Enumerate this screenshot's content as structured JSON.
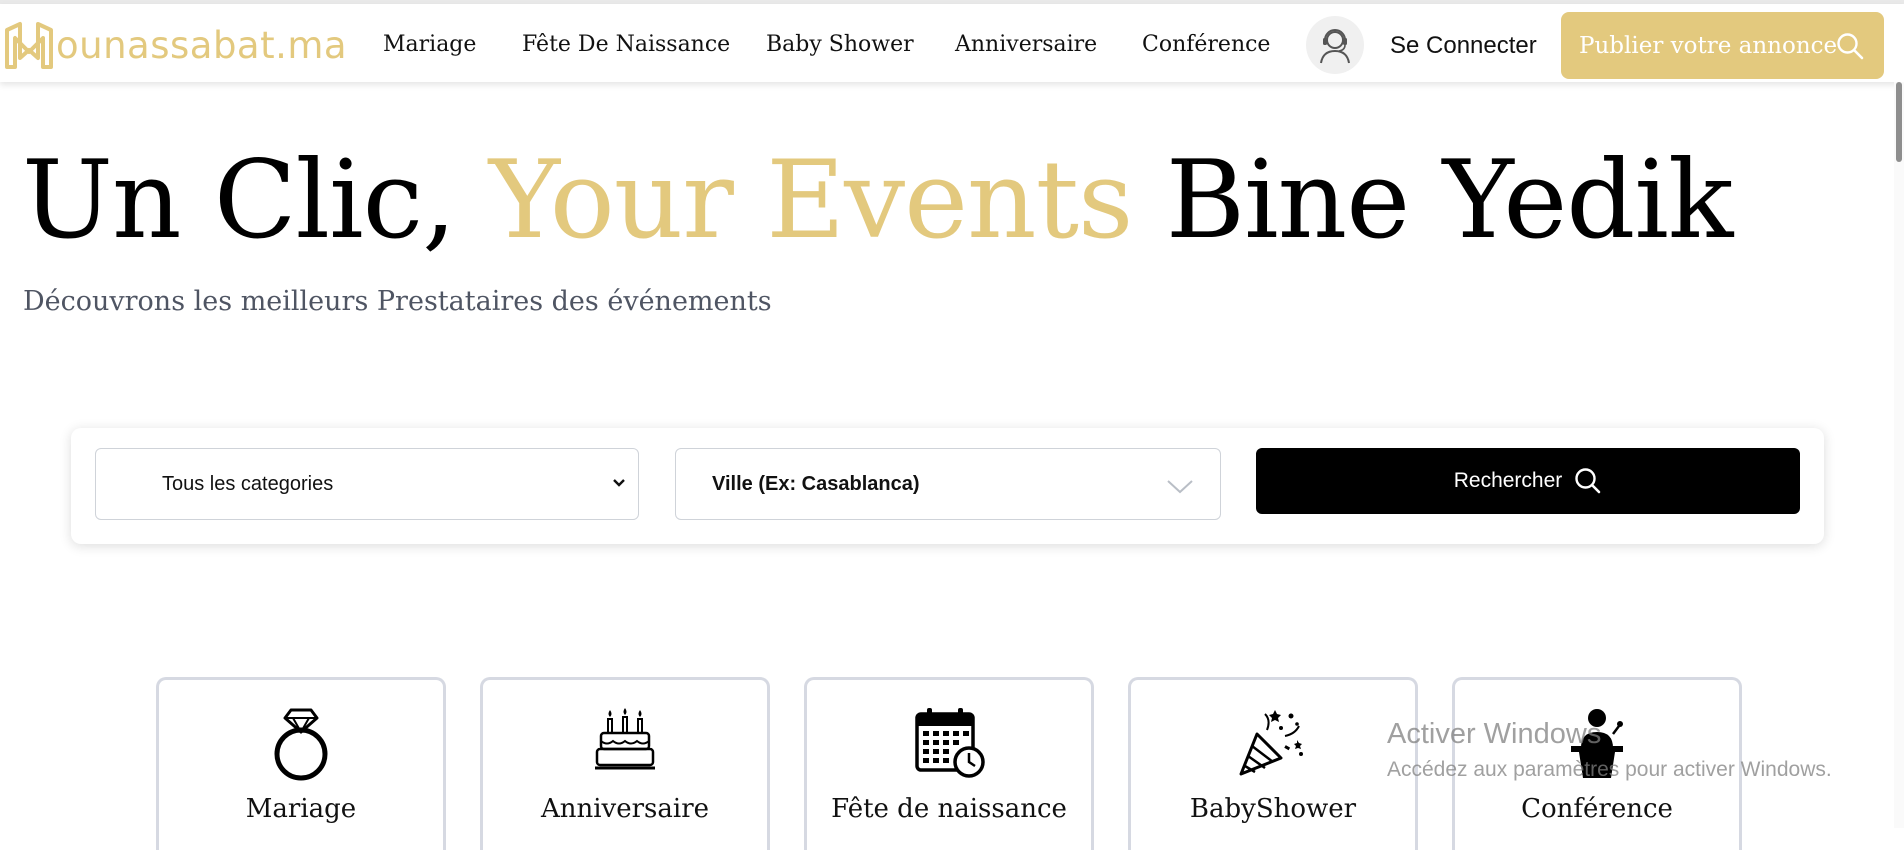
{
  "header": {
    "logo_text": "ounassabat.ma",
    "nav": [
      "Mariage",
      "Fête De Naissance",
      "Baby Shower",
      "Anniversaire",
      "Conférence"
    ],
    "login_label": "Se Connecter",
    "publish_label": "Publier votre annonce"
  },
  "hero": {
    "title_part1": "Un Clic,",
    "title_highlight": "Your Events",
    "title_part2": "Bine Yedik",
    "subtitle": "Découvrons les meilleurs Prestataires des événements"
  },
  "search": {
    "category_value": "Tous les categories",
    "city_placeholder": "Ville (Ex: Casablanca)",
    "button_label": "Rechercher"
  },
  "categories": [
    {
      "label": "Mariage",
      "icon": "ring-icon"
    },
    {
      "label": "Anniversaire",
      "icon": "birthday-cake-icon"
    },
    {
      "label": "Fête de naissance",
      "icon": "calendar-clock-icon"
    },
    {
      "label": "BabyShower",
      "icon": "party-popper-icon"
    },
    {
      "label": "Conférence",
      "icon": "speaker-podium-icon"
    }
  ],
  "watermark": {
    "title": "Activer Windows",
    "subtitle": "Accédez aux paramètres pour activer Windows."
  },
  "colors": {
    "accent": "#e3c97e",
    "button_dark": "#000000",
    "subtitle": "#4f5563"
  }
}
